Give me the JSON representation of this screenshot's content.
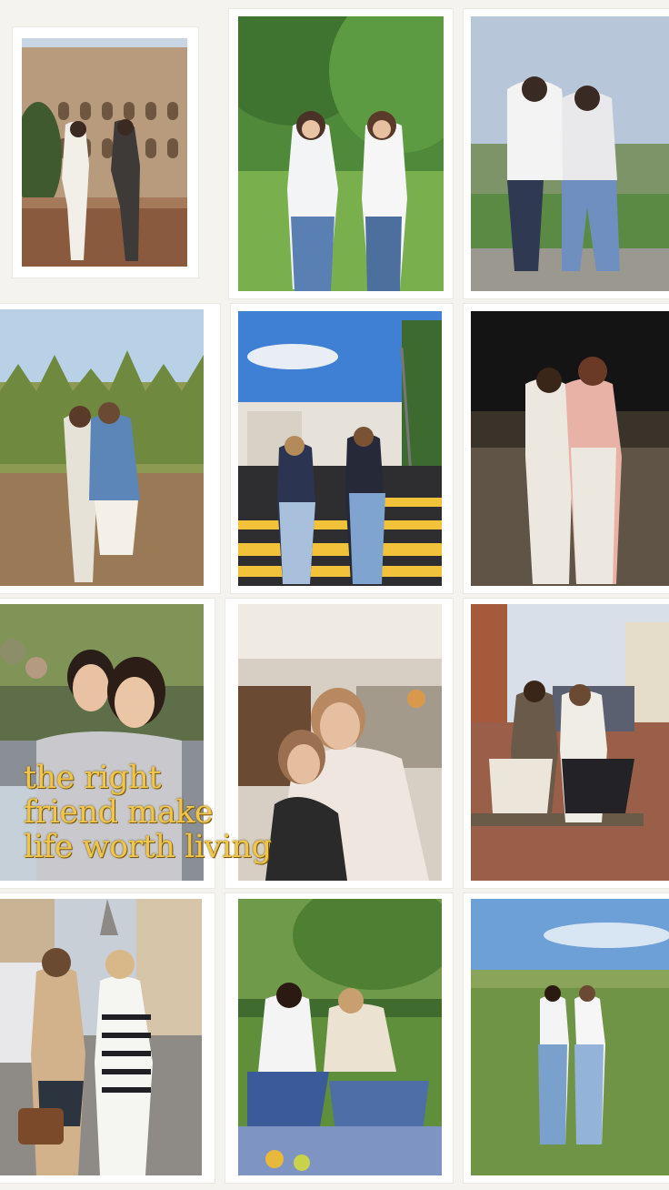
{
  "collage": {
    "background_color": "#f4f3ef",
    "quote_color": "#f0c64a",
    "quote_lines": [
      "the right",
      "friend make",
      "life worth living"
    ],
    "photos": [
      {
        "subject": "two friends sitting on a wall in front of the Colosseum"
      },
      {
        "subject": "two friends in white shirts and jeans on a green lawn"
      },
      {
        "subject": "two friends hugging, viewed from behind, overlooking a valley"
      },
      {
        "subject": "two friends with sunglasses in a corn maze"
      },
      {
        "subject": "two friends crossing a street crosswalk under blue sky"
      },
      {
        "subject": "two friends embracing in a town square at night"
      },
      {
        "subject": "two friends smiling cheek to cheek at a restaurant"
      },
      {
        "subject": "two friends laughing and hugging indoors"
      },
      {
        "subject": "two friends on a bench holding coffee cups"
      },
      {
        "subject": "two friends in coats on a Paris street near the Eiffel Tower"
      },
      {
        "subject": "two friends having a picnic in a park"
      },
      {
        "subject": "two friends standing in a wide green field"
      }
    ]
  }
}
